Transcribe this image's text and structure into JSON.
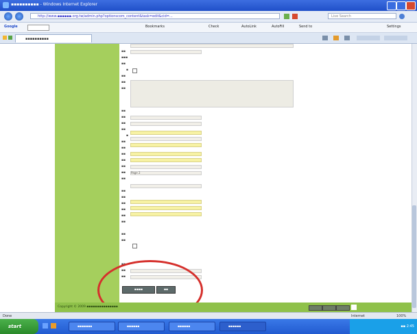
{
  "window": {
    "title": "▪▪▪▪▪▪▪▪▪▪ - Windows Internet Explorer"
  },
  "address": {
    "url": "http://www.▪▪▪▪▪▪.org.tw/admin.php?optionscom_content&task=edit&cid=...",
    "search_placeholder": "Live Search"
  },
  "toolbar": {
    "google_label": "Google",
    "bookmarks_label": "Bookmarks",
    "check_label": "Check",
    "autolink_label": "AutoLink",
    "autofill_label": "AutoFill",
    "send_label": "Send to",
    "settings_label": "Settings"
  },
  "tab": {
    "label": "▪▪▪▪▪▪▪▪▪▪"
  },
  "form": {
    "labels": [
      "▪▪",
      "▪▪▪",
      "▪▪",
      "▪",
      "▪▪",
      "▪▪",
      "▪▪",
      "▪▪",
      "▪▪",
      "▪▪",
      "▪▪",
      "▪",
      "▪▪",
      "▪▪",
      "▪▪",
      "▪▪",
      "▪▪",
      "▪▪",
      "▪▪",
      "▪▪",
      "▪▪",
      "▪▪",
      "▪▪",
      "▪▪",
      "▪▪",
      "▪▪",
      "▪▪",
      "▪▪",
      "▪▪",
      "▪▪"
    ],
    "value_field": "Page 2"
  },
  "buttons": {
    "submit": "▪▪▪▪",
    "cancel": "▪▪"
  },
  "footer": {
    "copyright": "Copyright © 2009 ▪▪▪▪▪▪▪▪▪▪▪▪▪▪▪"
  },
  "status": {
    "left": "Done",
    "zone": "Internet",
    "zoom": "100%"
  },
  "taskbar": {
    "start": "start",
    "tasks": [
      "▪▪▪▪▪▪▪",
      "▪▪▪▪▪▪",
      "▪▪▪▪▪▪",
      "▪▪▪▪▪▪"
    ],
    "clock": "▪▪ 2:45"
  }
}
